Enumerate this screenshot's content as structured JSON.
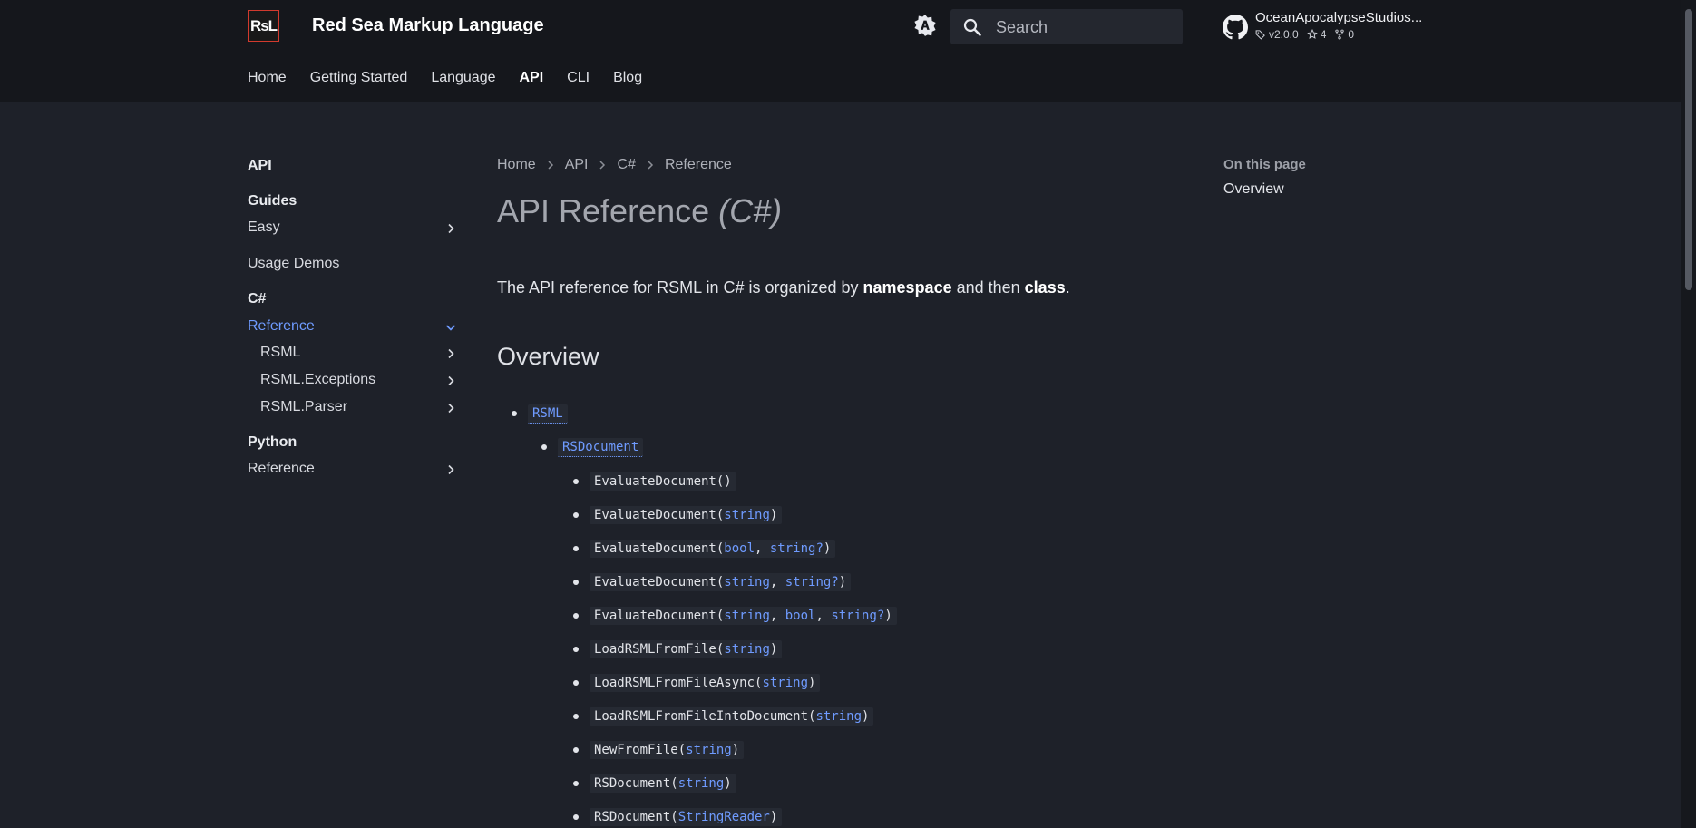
{
  "header": {
    "logo_text": "RsL",
    "site_title": "Red Sea Markup Language",
    "search_placeholder": "Search",
    "repo": {
      "name": "OceanApocalypseStudios...",
      "version": "v2.0.0",
      "stars": "4",
      "forks": "0"
    }
  },
  "tabs": [
    "Home",
    "Getting Started",
    "Language",
    "API",
    "CLI",
    "Blog"
  ],
  "active_tab": "API",
  "sidebar": {
    "title": "API",
    "sections": [
      {
        "heading": "Guides"
      },
      {
        "label": "Easy"
      },
      {
        "label": "Usage Demos"
      },
      {
        "heading": "C#"
      },
      {
        "label": "Reference"
      },
      {
        "label": "RSML"
      },
      {
        "label": "RSML.Exceptions"
      },
      {
        "label": "RSML.Parser"
      },
      {
        "heading": "Python"
      },
      {
        "label": "Reference"
      }
    ]
  },
  "breadcrumb": [
    "Home",
    "API",
    "C#",
    "Reference"
  ],
  "page": {
    "title_main": "API Reference",
    "title_em": "(C#)",
    "intro": {
      "p1": "The API reference for ",
      "abbr": "RSML",
      "p2": " in C# is organized by ",
      "b1": "namespace",
      "p3": " and then ",
      "b2": "class",
      "p4": "."
    },
    "overview_heading": "Overview"
  },
  "tree": {
    "namespace": "RSML",
    "class": "RSDocument",
    "members": [
      {
        "name": "EvaluateDocument",
        "params": []
      },
      {
        "name": "EvaluateDocument",
        "params": [
          "string"
        ]
      },
      {
        "name": "EvaluateDocument",
        "params": [
          "bool",
          "string?"
        ]
      },
      {
        "name": "EvaluateDocument",
        "params": [
          "string",
          "string?"
        ]
      },
      {
        "name": "EvaluateDocument",
        "params": [
          "string",
          "bool",
          "string?"
        ]
      },
      {
        "name": "LoadRSMLFromFile",
        "params": [
          "string"
        ]
      },
      {
        "name": "LoadRSMLFromFileAsync",
        "params": [
          "string"
        ]
      },
      {
        "name": "LoadRSMLFromFileIntoDocument",
        "params": [
          "string"
        ]
      },
      {
        "name": "NewFromFile",
        "params": [
          "string"
        ]
      },
      {
        "name": "RSDocument",
        "params": [
          "string"
        ]
      },
      {
        "name": "RSDocument",
        "params": [
          "StringReader"
        ]
      }
    ]
  },
  "toc": {
    "title": "On this page",
    "items": [
      "Overview"
    ]
  },
  "colors": {
    "background": "#1e2129",
    "header": "#15171c",
    "accent": "#6f9bff",
    "logo_border": "#d23a2e"
  }
}
